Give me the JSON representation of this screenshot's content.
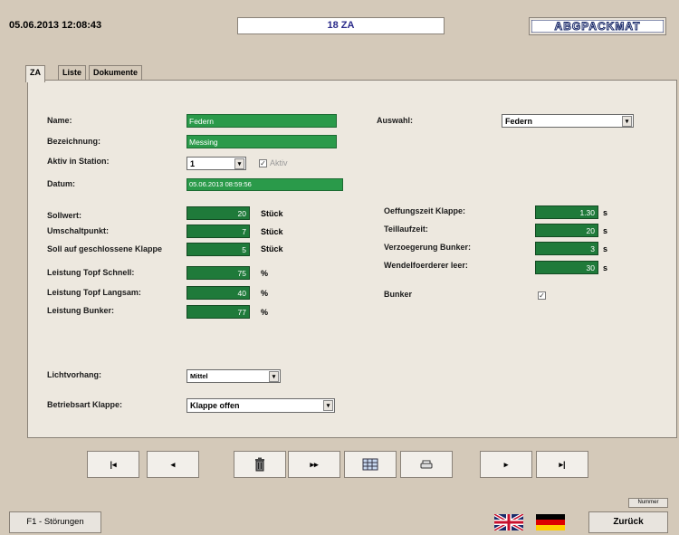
{
  "header": {
    "datetime": "05.06.2013  12:08:43",
    "title": "18 ZA",
    "logo_text": "ABGPACKMAT"
  },
  "tabs": [
    {
      "label": "ZA"
    },
    {
      "label": "Liste"
    },
    {
      "label": "Dokumente"
    }
  ],
  "form": {
    "name": {
      "label": "Name:",
      "value": "Federn"
    },
    "bezeichnung": {
      "label": "Bezeichnung:",
      "value": "Messing"
    },
    "aktiv_station": {
      "label": "Aktiv in Station:",
      "value": "1",
      "check_label": "Aktiv"
    },
    "datum": {
      "label": "Datum:",
      "value": "05.06.2013  08:59:56"
    },
    "auswahl": {
      "label": "Auswahl:",
      "value": "Federn"
    },
    "sollwert": {
      "label": "Sollwert:",
      "value": "20",
      "unit": "Stück"
    },
    "umschaltpunkt": {
      "label": "Umschaltpunkt:",
      "value": "7",
      "unit": "Stück"
    },
    "soll_klappe": {
      "label": "Soll auf geschlossene Klappe",
      "value": "5",
      "unit": "Stück"
    },
    "topf_schnell": {
      "label": "Leistung Topf Schnell:",
      "value": "75",
      "unit": "%"
    },
    "topf_langsam": {
      "label": "Leistung Topf Langsam:",
      "value": "40",
      "unit": "%"
    },
    "leistung_bunker": {
      "label": "Leistung Bunker:",
      "value": "77",
      "unit": "%"
    },
    "oeffnungszeit": {
      "label": "Oeffungszeit Klappe:",
      "value": "1.30",
      "unit": "s"
    },
    "teillaufzeit": {
      "label": "Teillaufzeit:",
      "value": "20",
      "unit": "s"
    },
    "verzoegerung": {
      "label": "Verzoegerung Bunker:",
      "value": "3",
      "unit": "s"
    },
    "wendel": {
      "label": "Wendelfoerderer leer:",
      "value": "30",
      "unit": "s"
    },
    "bunker": {
      "label": "Bunker",
      "checked": "✓"
    },
    "lichtvorhang": {
      "label": "Lichtvorhang:",
      "value": "Mittel"
    },
    "betriebsart": {
      "label": "Betriebsart Klappe:",
      "value": "Klappe offen"
    }
  },
  "nav": {
    "first": "|◂",
    "prev": "◂",
    "delete_icon": "trash-icon",
    "skip": "▸▸",
    "table_icon": "table-icon",
    "print_icon": "print-icon",
    "next": "▸",
    "last": "▸|"
  },
  "footer": {
    "f1": "F1 - Störungen",
    "nummer": "Nummer",
    "zurueck": "Zurück"
  },
  "colors": {
    "bg": "#d4c9b9",
    "green": "#2a9a4a",
    "dark_green": "#1f7a3a"
  }
}
